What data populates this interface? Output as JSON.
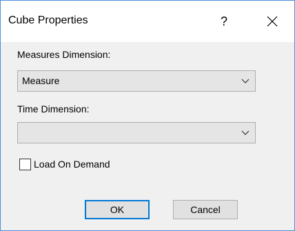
{
  "window": {
    "title": "Cube Properties",
    "help_label": "?",
    "close_icon": "close-icon"
  },
  "form": {
    "measures_label": "Measures Dimension:",
    "measures_value": "Measure",
    "time_label": "Time Dimension:",
    "time_value": "",
    "load_on_demand_label": "Load On Demand",
    "load_on_demand_checked": false
  },
  "buttons": {
    "ok_label": "OK",
    "cancel_label": "Cancel"
  },
  "colors": {
    "accent": "#0078d7",
    "window_border": "#4a8fd6",
    "dialog_background": "#f0f0f0"
  }
}
